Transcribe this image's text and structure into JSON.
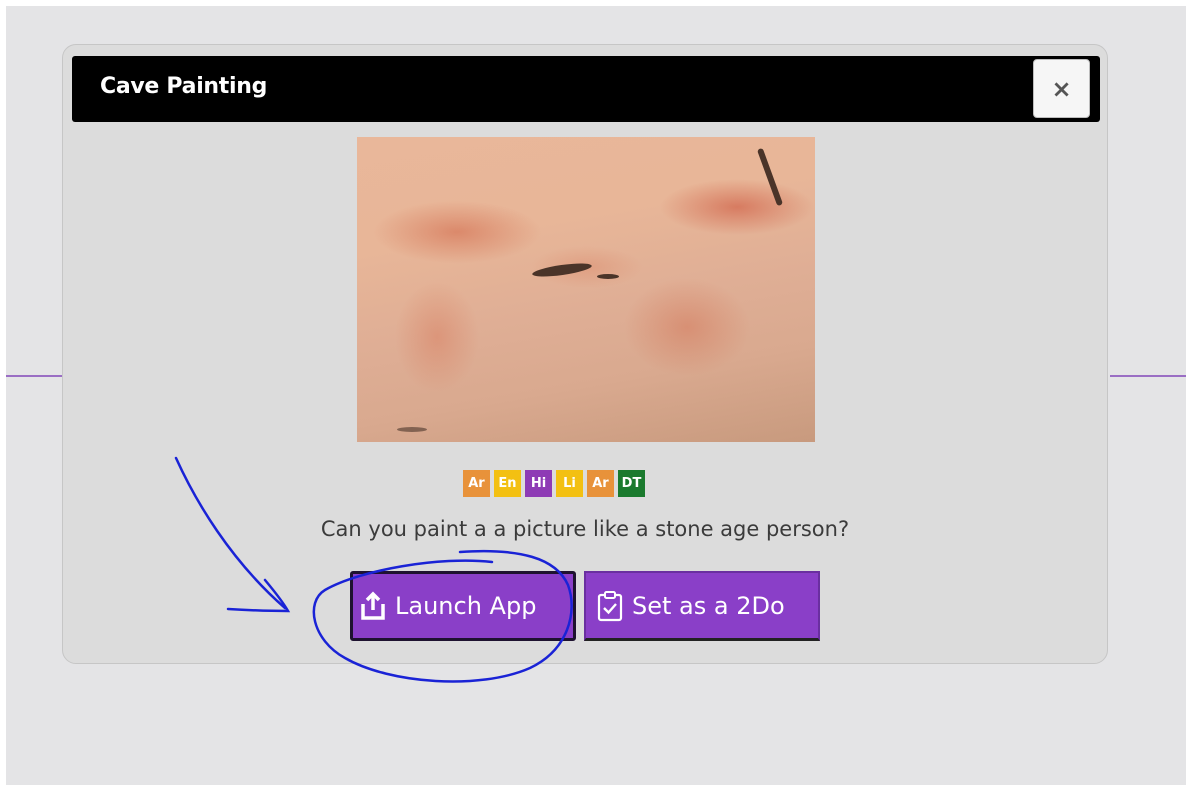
{
  "modal": {
    "title": "Cave Painting",
    "close_label": "×"
  },
  "app": {
    "tags": [
      {
        "label": "Ar",
        "color": "#e8923a"
      },
      {
        "label": "En",
        "color": "#f3c012"
      },
      {
        "label": "Hi",
        "color": "#8e3bb5"
      },
      {
        "label": "Li",
        "color": "#f3c012"
      },
      {
        "label": "Ar",
        "color": "#e8923a"
      },
      {
        "label": "DT",
        "color": "#1b7a2e"
      }
    ],
    "description": "Can you paint a a picture like a stone age person?"
  },
  "buttons": {
    "launch_label": "Launch App",
    "launch_icon": "upload-icon",
    "todo_label": "Set as a 2Do",
    "todo_icon": "clipboard-check-icon"
  },
  "colors": {
    "button_purple": "#8a3fc8",
    "annotation_blue": "#1a23d6"
  }
}
